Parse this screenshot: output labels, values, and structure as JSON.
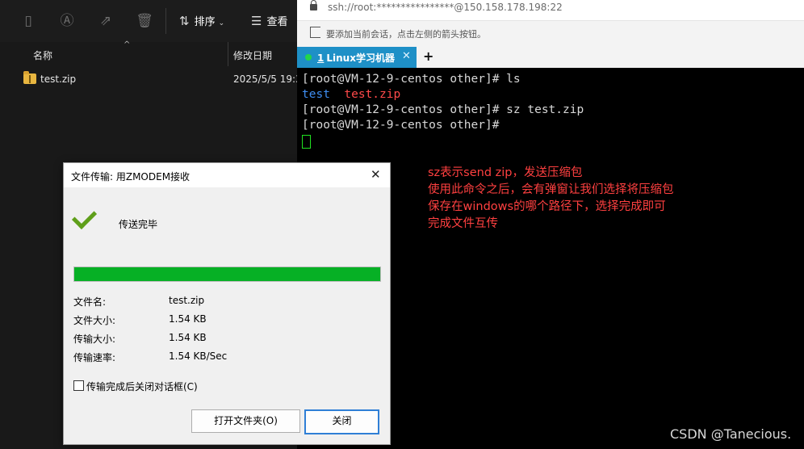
{
  "explorer": {
    "toolbar": {
      "sort_label": "排序",
      "view_label": "查看"
    },
    "columns": {
      "name": "名称",
      "modified": "修改日期"
    },
    "files": [
      {
        "name": "test.zip",
        "modified": "2025/5/5 19:3"
      }
    ]
  },
  "terminal_app": {
    "address": "ssh://root:****************@150.158.178.198:22",
    "hint": "要添加当前会话，点击左侧的箭头按钮。",
    "tab": {
      "index": "1",
      "label": "Linux学习机器"
    },
    "tab_status_color": "#22d64a",
    "accent_color": "#1e90c7",
    "terminal": {
      "lines": [
        {
          "prompt": "[root@VM-12-9-centos other]# ",
          "cmd": "ls"
        },
        {
          "out_blue": "test",
          "out_red": "test.zip"
        },
        {
          "prompt": "[root@VM-12-9-centos other]# ",
          "cmd": "sz test.zip"
        },
        {
          "prompt": "[root@VM-12-9-centos other]# ",
          "cmd": ""
        }
      ],
      "annotation": [
        "sz表示send zip，发送压缩包",
        "使用此命令之后，会有弹窗让我们选择将压缩包",
        "保存在windows的哪个路径下，选择完成即可",
        "完成文件互传"
      ]
    },
    "watermark": "CSDN @Tanecious."
  },
  "dialog": {
    "title": "文件传输: 用ZMODEM接收",
    "status": "传送完毕",
    "progress_fraction": 1.0,
    "progress_color": "#06b025",
    "fields": [
      {
        "label": "文件名:",
        "value": "test.zip"
      },
      {
        "label": "文件大小:",
        "value": "1.54 KB"
      },
      {
        "label": "传输大小:",
        "value": "1.54 KB"
      },
      {
        "label": "传输速率:",
        "value": "1.54 KB/Sec"
      }
    ],
    "close_on_complete_label": "传输完成后关闭对话框(C)",
    "close_on_complete_checked": false,
    "open_folder_button": "打开文件夹(O)",
    "close_button": "关闭"
  }
}
